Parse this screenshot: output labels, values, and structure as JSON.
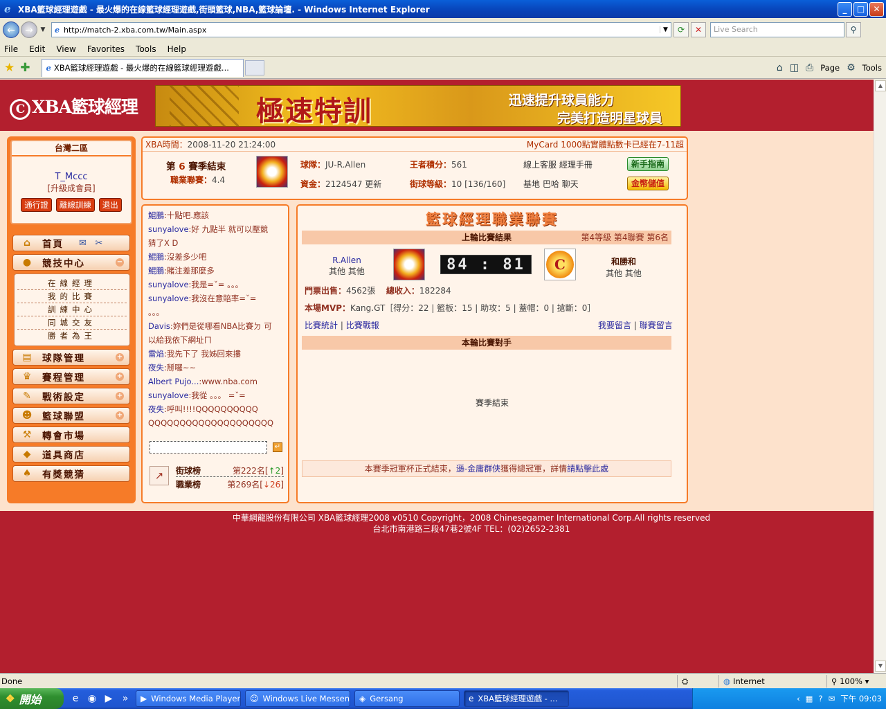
{
  "window": {
    "title": "XBA籃球經理遊戲 - 最火爆的在線籃球經理遊戲,街頭籃球,NBA,籃球論壇. - Windows Internet Explorer",
    "minimize": "_",
    "maximize": "□",
    "close": "✕"
  },
  "browser": {
    "url": "http://match-2.xba.com.tw/Main.aspx",
    "search_placeholder": "Live Search",
    "menu": [
      "File",
      "Edit",
      "View",
      "Favorites",
      "Tools",
      "Help"
    ],
    "tab_title": "XBA籃球經理遊戲 - 最火爆的在線籃球經理遊戲...",
    "commands": {
      "page": "Page",
      "tools": "Tools"
    },
    "status": "Done",
    "zone": "Internet",
    "zoom": "100%"
  },
  "site": {
    "logo": "XBA籃球經理",
    "banner": {
      "headline": "極速特訓",
      "line1": "迅速提升球員能力",
      "line2": "完美打造明星球員"
    }
  },
  "user": {
    "region": "台灣二區",
    "name": "T_Mccc",
    "level": "[升級成會員]",
    "buttons": [
      "通行證",
      "離線訓練",
      "退出"
    ]
  },
  "sidebar": {
    "home": "首頁",
    "compete": "競技中心",
    "compete_sub": [
      "在線經理",
      "我的比賽",
      "訓練中心",
      "同城交友",
      "勝者為王"
    ],
    "items": [
      "球隊管理",
      "賽程管理",
      "戰術設定",
      "籃球聯盟",
      "轉會市場",
      "道具商店",
      "有獎競猜"
    ]
  },
  "info": {
    "time_label": "XBA時間：",
    "time_value": "2008-11-20 21:24:00",
    "notice": "MyCard 1000點實體點數卡已經在7-11超",
    "season_prefix": "第",
    "season_num": "6",
    "season_suffix": "賽季結束",
    "career_label": "職業聯賽：",
    "career_value": "4.4",
    "team_label": "球隊：",
    "team_value": "JU-R.Allen",
    "king_label": "王者積分：",
    "king_value": "561",
    "funds_label": "資金：",
    "funds_value": "2124547",
    "update": "更新",
    "street_label": "街球等級：",
    "street_value": "10 [136/160]",
    "links_row1": "線上客服  經理手冊",
    "links_row2": "基地  巴哈  聊天",
    "guide_btn": "新手指南",
    "coin_btn": "金幣儲值"
  },
  "chat": [
    {
      "who": "鯤鵬",
      "msg": ":十點吧.應該"
    },
    {
      "who": "sunyalove",
      "msg": ":好   九點半   就可以壓競"
    },
    {
      "who": "",
      "msg": "猜了X D"
    },
    {
      "who": "鯤鵬",
      "msg": ":沒差多少吧"
    },
    {
      "who": "鯤鵬",
      "msg": ":賭注差那麼多"
    },
    {
      "who": "sunyalove",
      "msg": ":我是=ˇ=   。。。"
    },
    {
      "who": "sunyalove",
      "msg": ":我沒在意賠率=ˇ="
    },
    {
      "who": "",
      "msg": "。。。"
    },
    {
      "who": "Davis",
      "msg": ":妳們是從哪看NBA比賽ㄉ 可"
    },
    {
      "who": "",
      "msg": "以給我依下網址ㄇ"
    },
    {
      "who": "雷焰",
      "msg": ":我先下了  我姊回來摟"
    },
    {
      "who": "夜失",
      "msg": ":掰囉~~"
    },
    {
      "who": "Albert Pujo...",
      "msg": ":www.nba.com"
    },
    {
      "who": "sunyalove",
      "msg": ":我從  。。。   =ˇ="
    },
    {
      "who": "夜失",
      "msg": ":呼叫!!!!QQQQQQQQQQ"
    },
    {
      "who": "",
      "msg": "QQQQQQQQQQQQQQQQQQQQ"
    }
  ],
  "rank": {
    "street_name": "街球榜",
    "street_value": "第222名[",
    "street_change": "↑2",
    "career_name": "職業榜",
    "career_value": "第269名[",
    "career_change": "↓26",
    "close": "]"
  },
  "league": {
    "title": "籃球經理職業聯賽",
    "last_round": "上輪比賽結果",
    "position": "第4等級  第4聯賽  第6名",
    "home_team": "R.Allen",
    "home_sub": "其他  其他",
    "away_team": "和勝和",
    "away_sub": "其他  其他",
    "score": "84 : 81",
    "tickets_label": "門票出售：",
    "tickets_value": "4562張",
    "revenue_label": "總收入：",
    "revenue_value": "182284",
    "mvp_label": "本場MVP：",
    "mvp_value": "Kang.GT［得分：22 | 籃板：15 | 助攻：5 | 蓋帽：0 | 搶斷：0］",
    "stats_link": "比賽統計",
    "report_link": "比賽戰報",
    "msg_link": "我要留言",
    "league_msg_link": "聯賽留言",
    "this_round": "本輪比賽對手",
    "season_end": "賽季結束",
    "champ_prefix": "本賽季冠軍杯正式結束，",
    "champ_team": "遜-金庸群俠",
    "champ_mid": "獲得總冠軍，詳情",
    "champ_link": "請點擊此處"
  },
  "footer": {
    "line1": "中華網龍股份有限公司  XBA籃球經理2008 v0510     Copyright，2008 Chinesegamer International Corp.All rights reserved",
    "line2": "台北市南港路三段47巷2號4F TEL：(02)2652-2381"
  },
  "taskbar": {
    "start": "開始",
    "items": [
      "Windows Media Player",
      "Windows Live Messen...",
      "Gersang",
      "XBA籃球經理遊戲 - ..."
    ],
    "clock": "下午 09:03"
  }
}
